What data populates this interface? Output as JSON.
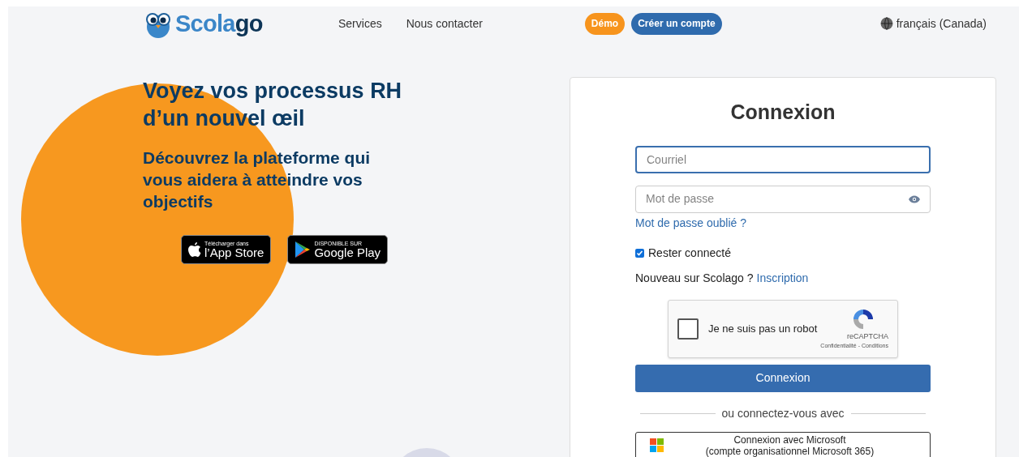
{
  "header": {
    "logo": [
      "Scola",
      "go"
    ],
    "nav": [
      "Services",
      "Nous contacter"
    ],
    "buttons": [
      {
        "label": "Démo",
        "kind": "demo"
      },
      {
        "label": "Créer un compte",
        "kind": "signup"
      }
    ],
    "language": "français (Canada)"
  },
  "hero": {
    "title": "Voyez vos processus RH d’un nouvel œil",
    "subtitle": "Découvrez la plateforme qui vous aidera à atteindre vos objectifs",
    "stores": [
      {
        "kind": "apple",
        "small": "Télécharger dans",
        "big": "l’App Store"
      },
      {
        "kind": "google",
        "small": "DISPONIBLE SUR",
        "big": "Google Play"
      }
    ]
  },
  "login": {
    "title": "Connexion",
    "email": {
      "placeholder": "Courriel",
      "focused": true
    },
    "password": {
      "placeholder": "Mot de passe"
    },
    "forgot": "Mot de passe oublié ?",
    "remember": {
      "label": "Rester connecté",
      "checked": true
    },
    "new_user": "Nouveau sur Scolago ?",
    "signup_link": "Inscription",
    "captcha": {
      "label": "Je ne suis pas un robot",
      "checked": false,
      "brand": "reCAPTCHA",
      "links": "Confidentialité - Conditions"
    },
    "submit": "Connexion",
    "divider": "ou connectez-vous avec",
    "microsoft": [
      "Connexion avec Microsoft",
      "(compte organisationnel Microsoft 365)"
    ]
  }
}
